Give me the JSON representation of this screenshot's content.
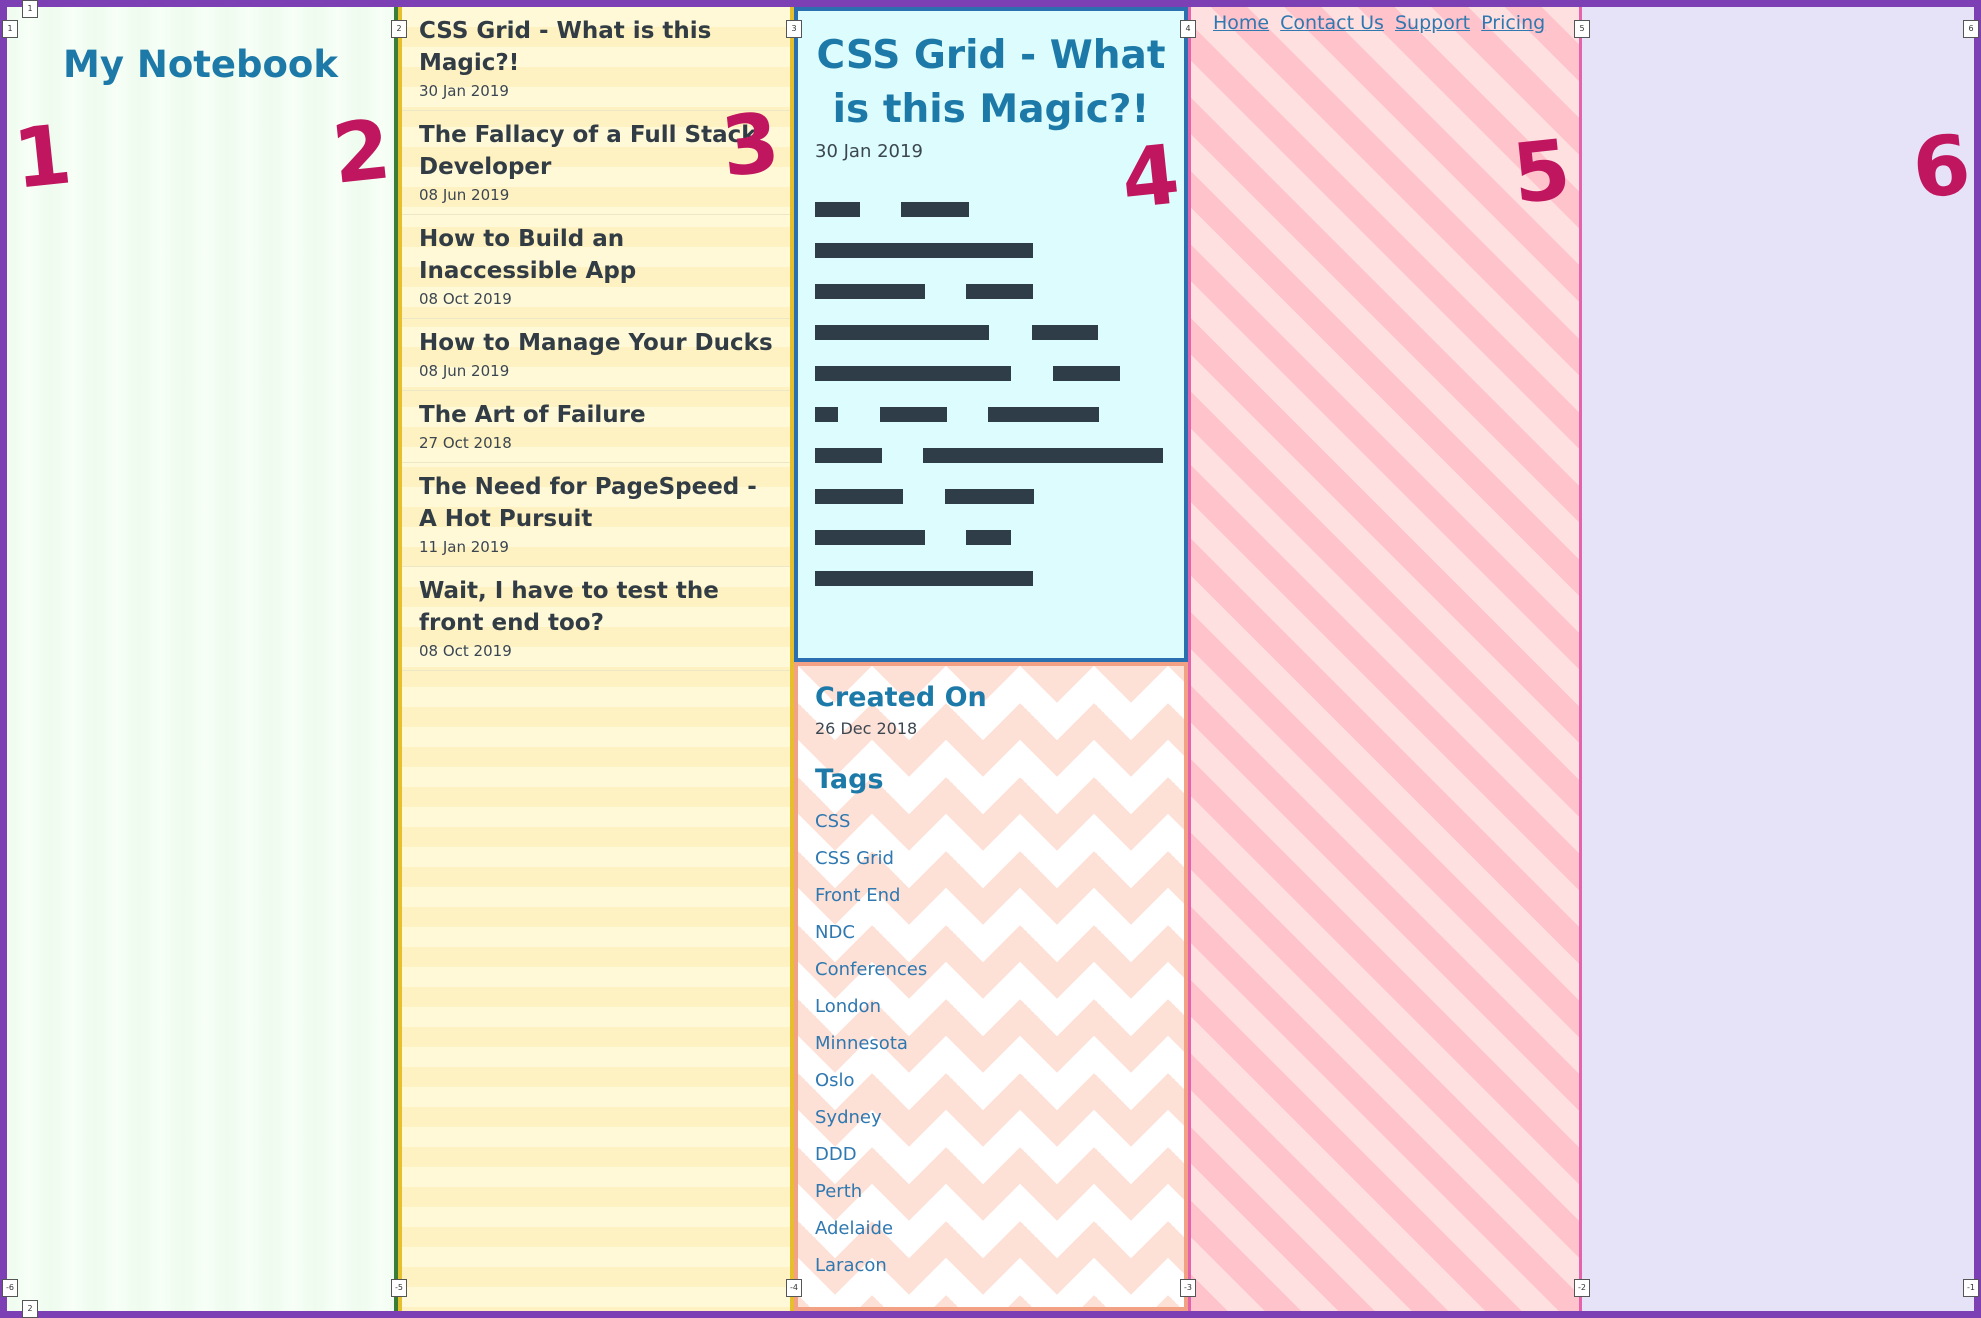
{
  "brand": {
    "title": "My Notebook"
  },
  "posts": [
    {
      "title": "CSS Grid - What is this Magic?!",
      "date": "30 Jan 2019"
    },
    {
      "title": "The Fallacy of a Full Stack Developer",
      "date": "08 Jun 2019"
    },
    {
      "title": "How to Build an Inaccessible App",
      "date": "08 Oct 2019"
    },
    {
      "title": "How to Manage Your Ducks",
      "date": "08 Jun 2019"
    },
    {
      "title": "The Art of Failure",
      "date": "27 Oct 2018"
    },
    {
      "title": "The Need for PageSpeed - A Hot Pursuit",
      "date": "11 Jan 2019"
    },
    {
      "title": "Wait, I have to test the front end too?",
      "date": "08 Oct 2019"
    }
  ],
  "article": {
    "title": "CSS Grid - What is this Magic?!",
    "date": "30 Jan 2019"
  },
  "meta": {
    "created_heading": "Created On",
    "created_date": "26 Dec 2018",
    "tags_heading": "Tags",
    "tags": [
      "CSS",
      "CSS Grid",
      "Front End",
      "NDC",
      "Conferences",
      "London",
      "Minnesota",
      "Oslo",
      "Sydney",
      "DDD",
      "Perth",
      "Adelaide",
      "Laracon"
    ]
  },
  "nav": {
    "home": "Home",
    "contact": "Contact Us",
    "support": "Support",
    "pricing": "Pricing"
  },
  "overlay_numbers": [
    "1",
    "2",
    "3",
    "4",
    "5",
    "6"
  ],
  "grid_line_labels": {
    "top": [
      "1",
      "2",
      "3",
      "4",
      "5",
      "6",
      "1"
    ],
    "bottom": [
      "-6",
      "2",
      "-5",
      "-4",
      "-3",
      "-2",
      "-1"
    ]
  },
  "colors": {
    "accent": "#1d7aa8",
    "annotation": "#c0155f",
    "frame": "#7d3fb4"
  }
}
